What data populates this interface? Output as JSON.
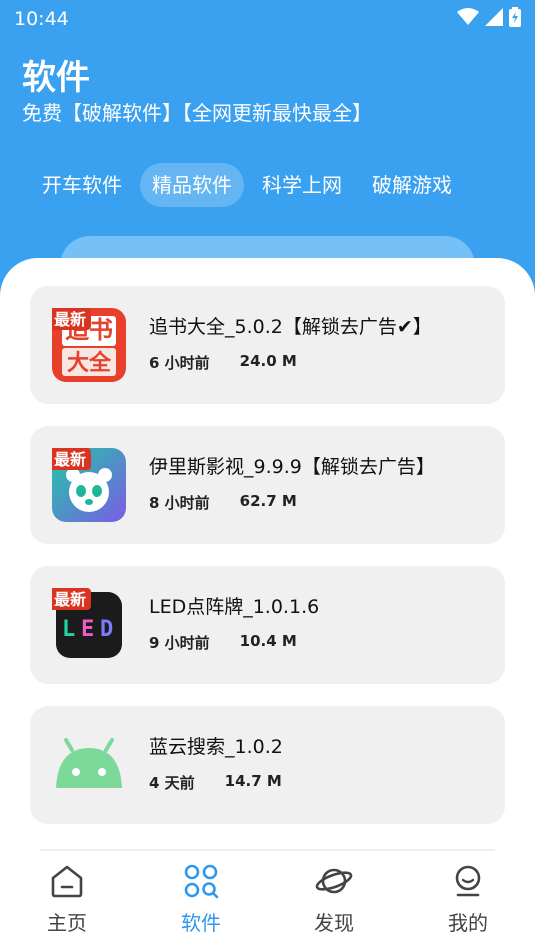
{
  "status_bar": {
    "time": "10:44"
  },
  "header": {
    "title": "软件",
    "subtitle": "免费【破解软件】【全网更新最快最全】"
  },
  "tabs": [
    {
      "label": "开车软件",
      "active": false
    },
    {
      "label": "精品软件",
      "active": true
    },
    {
      "label": "科学上网",
      "active": false
    },
    {
      "label": "破解游戏",
      "active": false
    }
  ],
  "apps": [
    {
      "title": "追书大全_5.0.2【解锁去广告✔】",
      "time": "6 小时前",
      "size": "24.0 M",
      "icon": "zhuishu-app-icon",
      "badge": "最新"
    },
    {
      "title": "伊里斯影视_9.9.9【解锁去广告】",
      "time": "8 小时前",
      "size": "62.7 M",
      "icon": "panda-app-icon",
      "badge": "最新"
    },
    {
      "title": "LED点阵牌_1.0.1.6",
      "time": "9 小时前",
      "size": "10.4 M",
      "icon": "led-app-icon",
      "badge": "最新"
    },
    {
      "title": "蓝云搜索_1.0.2",
      "time": "4 天前",
      "size": "14.7 M",
      "icon": "android-icon",
      "badge": ""
    }
  ],
  "bottom_nav": [
    {
      "label": "主页",
      "icon": "home-icon",
      "active": false
    },
    {
      "label": "软件",
      "icon": "apps-icon",
      "active": true
    },
    {
      "label": "发现",
      "icon": "planet-icon",
      "active": false
    },
    {
      "label": "我的",
      "icon": "profile-icon",
      "active": false
    }
  ],
  "colors": {
    "primary": "#3aa1f0",
    "active_nav": "#2f98ec",
    "card_bg": "#f0f0f0"
  }
}
